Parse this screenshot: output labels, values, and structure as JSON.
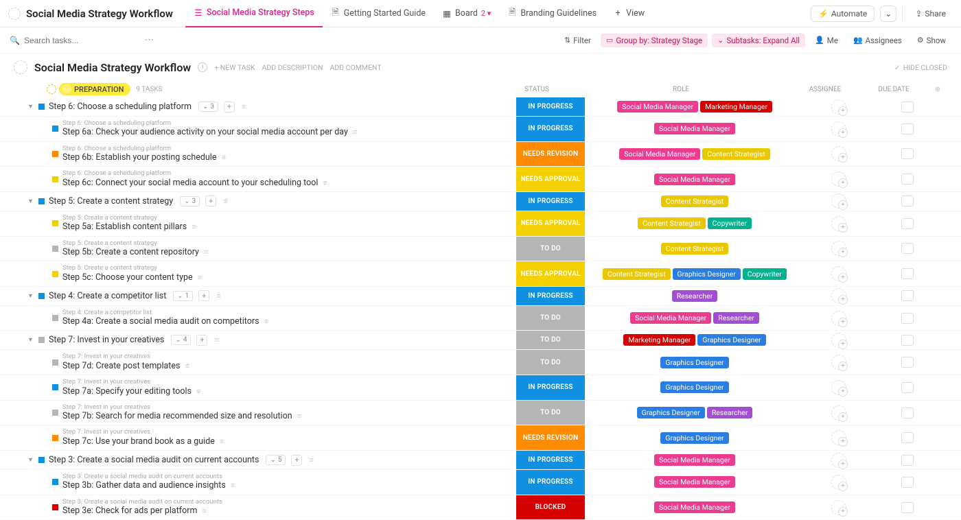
{
  "header": {
    "title": "Social Media Strategy Workflow",
    "tabs": [
      {
        "label": "Social Media Strategy Steps",
        "icon": "list",
        "active": true
      },
      {
        "label": "Getting Started Guide",
        "icon": "doc"
      },
      {
        "label": "Board",
        "icon": "board",
        "badge": "2"
      },
      {
        "label": "Branding Guidelines",
        "icon": "doc"
      },
      {
        "label": "View",
        "icon": "plus"
      }
    ],
    "automate": "Automate",
    "share": "Share"
  },
  "toolbar": {
    "search_placeholder": "Search tasks...",
    "filter": "Filter",
    "group_by": "Group by: Strategy Stage",
    "subtasks": "Subtasks: Expand All",
    "me": "Me",
    "assignees": "Assignees",
    "show": "Show"
  },
  "list": {
    "title": "Social Media Strategy Workflow",
    "new_task": "+ NEW TASK",
    "add_description": "ADD DESCRIPTION",
    "add_comment": "ADD COMMENT",
    "hide_closed": "HIDE CLOSED"
  },
  "columns": {
    "status": "STATUS",
    "role": "ROLE",
    "assignee": "ASSIGNEE",
    "due_date": "DUE DATE"
  },
  "group": {
    "name": "Preparation",
    "count": "9 TASKS"
  },
  "status_colors": {
    "IN PROGRESS": "#1090e0",
    "NEEDS REVISION": "#ff8c00",
    "NEEDS APPROVAL": "#f5d000",
    "TO DO": "#b5b5b5",
    "BLOCKED": "#d50000"
  },
  "role_colors": {
    "Social Media Manager": "#eb3c8f",
    "Marketing Manager": "#d50000",
    "Content Strategist": "#eac800",
    "Copywriter": "#00b28f",
    "Graphics Designer": "#2a7de1",
    "Researcher": "#a44cd3"
  },
  "sq_colors": {
    "blue": "#1090e0",
    "orange": "#ff8c00",
    "yellow": "#f5d000",
    "gray": "#b5b5b5",
    "red": "#d50000"
  },
  "rows": [
    {
      "type": "parent",
      "sq": "blue",
      "name": "Step 6: Choose a scheduling platform",
      "sub_count": "3",
      "status": "IN PROGRESS",
      "roles": [
        "Social Media Manager",
        "Marketing Manager"
      ]
    },
    {
      "type": "sub",
      "sq": "blue",
      "pname": "Step 6: Choose a scheduling platform",
      "name": "Step 6a: Check your audience activity on your social media account per day",
      "status": "IN PROGRESS",
      "roles": [
        "Social Media Manager"
      ]
    },
    {
      "type": "sub",
      "sq": "orange",
      "pname": "Step 6: Choose a scheduling platform",
      "name": "Step 6b: Establish your posting schedule",
      "status": "NEEDS REVISION",
      "roles": [
        "Social Media Manager",
        "Content Strategist"
      ]
    },
    {
      "type": "sub",
      "sq": "yellow",
      "pname": "Step 6: Choose a scheduling platform",
      "name": "Step 6c: Connect your social media account to your scheduling tool",
      "status": "NEEDS APPROVAL",
      "roles": [
        "Social Media Manager"
      ]
    },
    {
      "type": "parent",
      "sq": "blue",
      "name": "Step 5: Create a content strategy",
      "sub_count": "3",
      "status": "IN PROGRESS",
      "roles": [
        "Content Strategist"
      ]
    },
    {
      "type": "sub",
      "sq": "yellow",
      "pname": "Step 5: Create a content strategy",
      "name": "Step 5a: Establish content pillars",
      "status": "NEEDS APPROVAL",
      "roles": [
        "Content Strategist",
        "Copywriter"
      ]
    },
    {
      "type": "sub",
      "sq": "gray",
      "pname": "Step 5: Create a content strategy",
      "name": "Step 5b: Create a content repository",
      "status": "TO DO",
      "roles": [
        "Content Strategist"
      ]
    },
    {
      "type": "sub",
      "sq": "yellow",
      "pname": "Step 5: Create a content strategy",
      "name": "Step 5c: Choose your content type",
      "status": "NEEDS APPROVAL",
      "roles": [
        "Content Strategist",
        "Graphics Designer",
        "Copywriter"
      ]
    },
    {
      "type": "parent",
      "sq": "blue",
      "name": "Step 4: Create a competitor list",
      "sub_count": "1",
      "status": "IN PROGRESS",
      "roles": [
        "Researcher"
      ]
    },
    {
      "type": "sub",
      "sq": "gray",
      "pname": "Step 4: Create a competitor list",
      "name": "Step 4a: Create a social media audit on competitors",
      "status": "TO DO",
      "roles": [
        "Social Media Manager",
        "Researcher"
      ]
    },
    {
      "type": "parent",
      "sq": "gray",
      "name": "Step 7: Invest in your creatives",
      "sub_count": "4",
      "status": "TO DO",
      "roles": [
        "Marketing Manager",
        "Graphics Designer"
      ]
    },
    {
      "type": "sub",
      "sq": "gray",
      "pname": "Step 7: Invest in your creatives",
      "name": "Step 7d: Create post templates",
      "status": "TO DO",
      "roles": [
        "Graphics Designer"
      ]
    },
    {
      "type": "sub",
      "sq": "blue",
      "pname": "Step 7: Invest in your creatives",
      "name": "Step 7a: Specify your editing tools",
      "status": "IN PROGRESS",
      "roles": [
        "Graphics Designer"
      ]
    },
    {
      "type": "sub",
      "sq": "gray",
      "pname": "Step 7: Invest in your creatives",
      "name": "Step 7b: Search for media recommended size and resolution",
      "status": "TO DO",
      "roles": [
        "Graphics Designer",
        "Researcher"
      ]
    },
    {
      "type": "sub",
      "sq": "orange",
      "pname": "Step 7: Invest in your creatives",
      "name": "Step 7c: Use your brand book as a guide",
      "status": "NEEDS REVISION",
      "roles": [
        "Graphics Designer"
      ]
    },
    {
      "type": "parent",
      "sq": "blue",
      "name": "Step 3: Create a social media audit on current accounts",
      "sub_count": "5",
      "status": "IN PROGRESS",
      "roles": [
        "Social Media Manager"
      ]
    },
    {
      "type": "sub",
      "sq": "blue",
      "pname": "Step 3: Create a social media audit on current accounts",
      "name": "Step 3b: Gather data and audience insights",
      "status": "IN PROGRESS",
      "roles": [
        "Social Media Manager"
      ]
    },
    {
      "type": "sub",
      "sq": "red",
      "pname": "Step 3: Create a social media audit on current accounts",
      "name": "Step 3e: Check for ads per platform",
      "status": "BLOCKED",
      "roles": [
        "Social Media Manager"
      ]
    }
  ]
}
